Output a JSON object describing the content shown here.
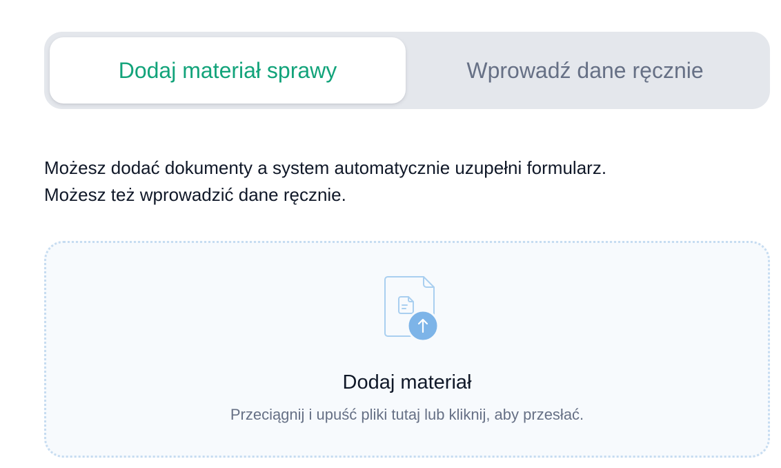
{
  "tabs": {
    "active_label": "Dodaj materiał sprawy",
    "inactive_label": "Wprowadź dane ręcznie"
  },
  "description": {
    "line1": "Możesz dodać dokumenty a system automatycznie uzupełni formularz.",
    "line2": "Możesz też wprowadzić dane ręcznie."
  },
  "dropzone": {
    "icon": "file-upload-icon",
    "title": "Dodaj materiał",
    "hint": "Przeciągnij i upuść pliki tutaj lub kliknij, aby przesłać."
  },
  "colors": {
    "active_tab_text": "#12a37a",
    "inactive_tab_text": "#667085",
    "tabs_background": "#e4e7ec",
    "dropzone_border": "#c6dcf1",
    "dropzone_background": "#f7fafd",
    "upload_badge": "#7db4e8"
  }
}
